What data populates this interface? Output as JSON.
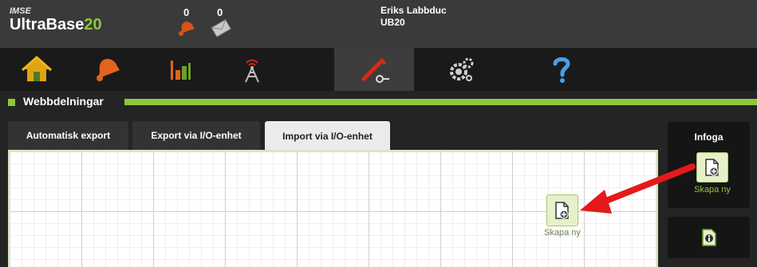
{
  "header": {
    "brand_small": "IMSE",
    "brand_name": "UltraBase",
    "brand_version": "20",
    "alarm_count": "0",
    "message_count": "0",
    "user_name": "Eriks Labbduc",
    "user_db": "UB20"
  },
  "nav": {
    "items": [
      {
        "icon": "home-icon"
      },
      {
        "icon": "bell-icon"
      },
      {
        "icon": "bar-chart-icon"
      },
      {
        "icon": "antenna-icon"
      },
      {
        "icon": "tools-icon",
        "active": true
      },
      {
        "icon": "gears-icon"
      },
      {
        "icon": "help-icon"
      }
    ]
  },
  "section": {
    "title": "Webbdelningar"
  },
  "tabs": [
    {
      "label": "Automatisk export"
    },
    {
      "label": "Export via I/O-enhet"
    },
    {
      "label": "Import via I/O-enhet",
      "active": true
    }
  ],
  "canvas": {
    "node_label": "Skapa ny"
  },
  "insert_panel": {
    "title": "Infoga",
    "create_label": "Skapa ny"
  },
  "colors": {
    "accent_green": "#8dc63f",
    "header_bg": "#3a3a3a",
    "arrow_red": "#e41a1a"
  }
}
